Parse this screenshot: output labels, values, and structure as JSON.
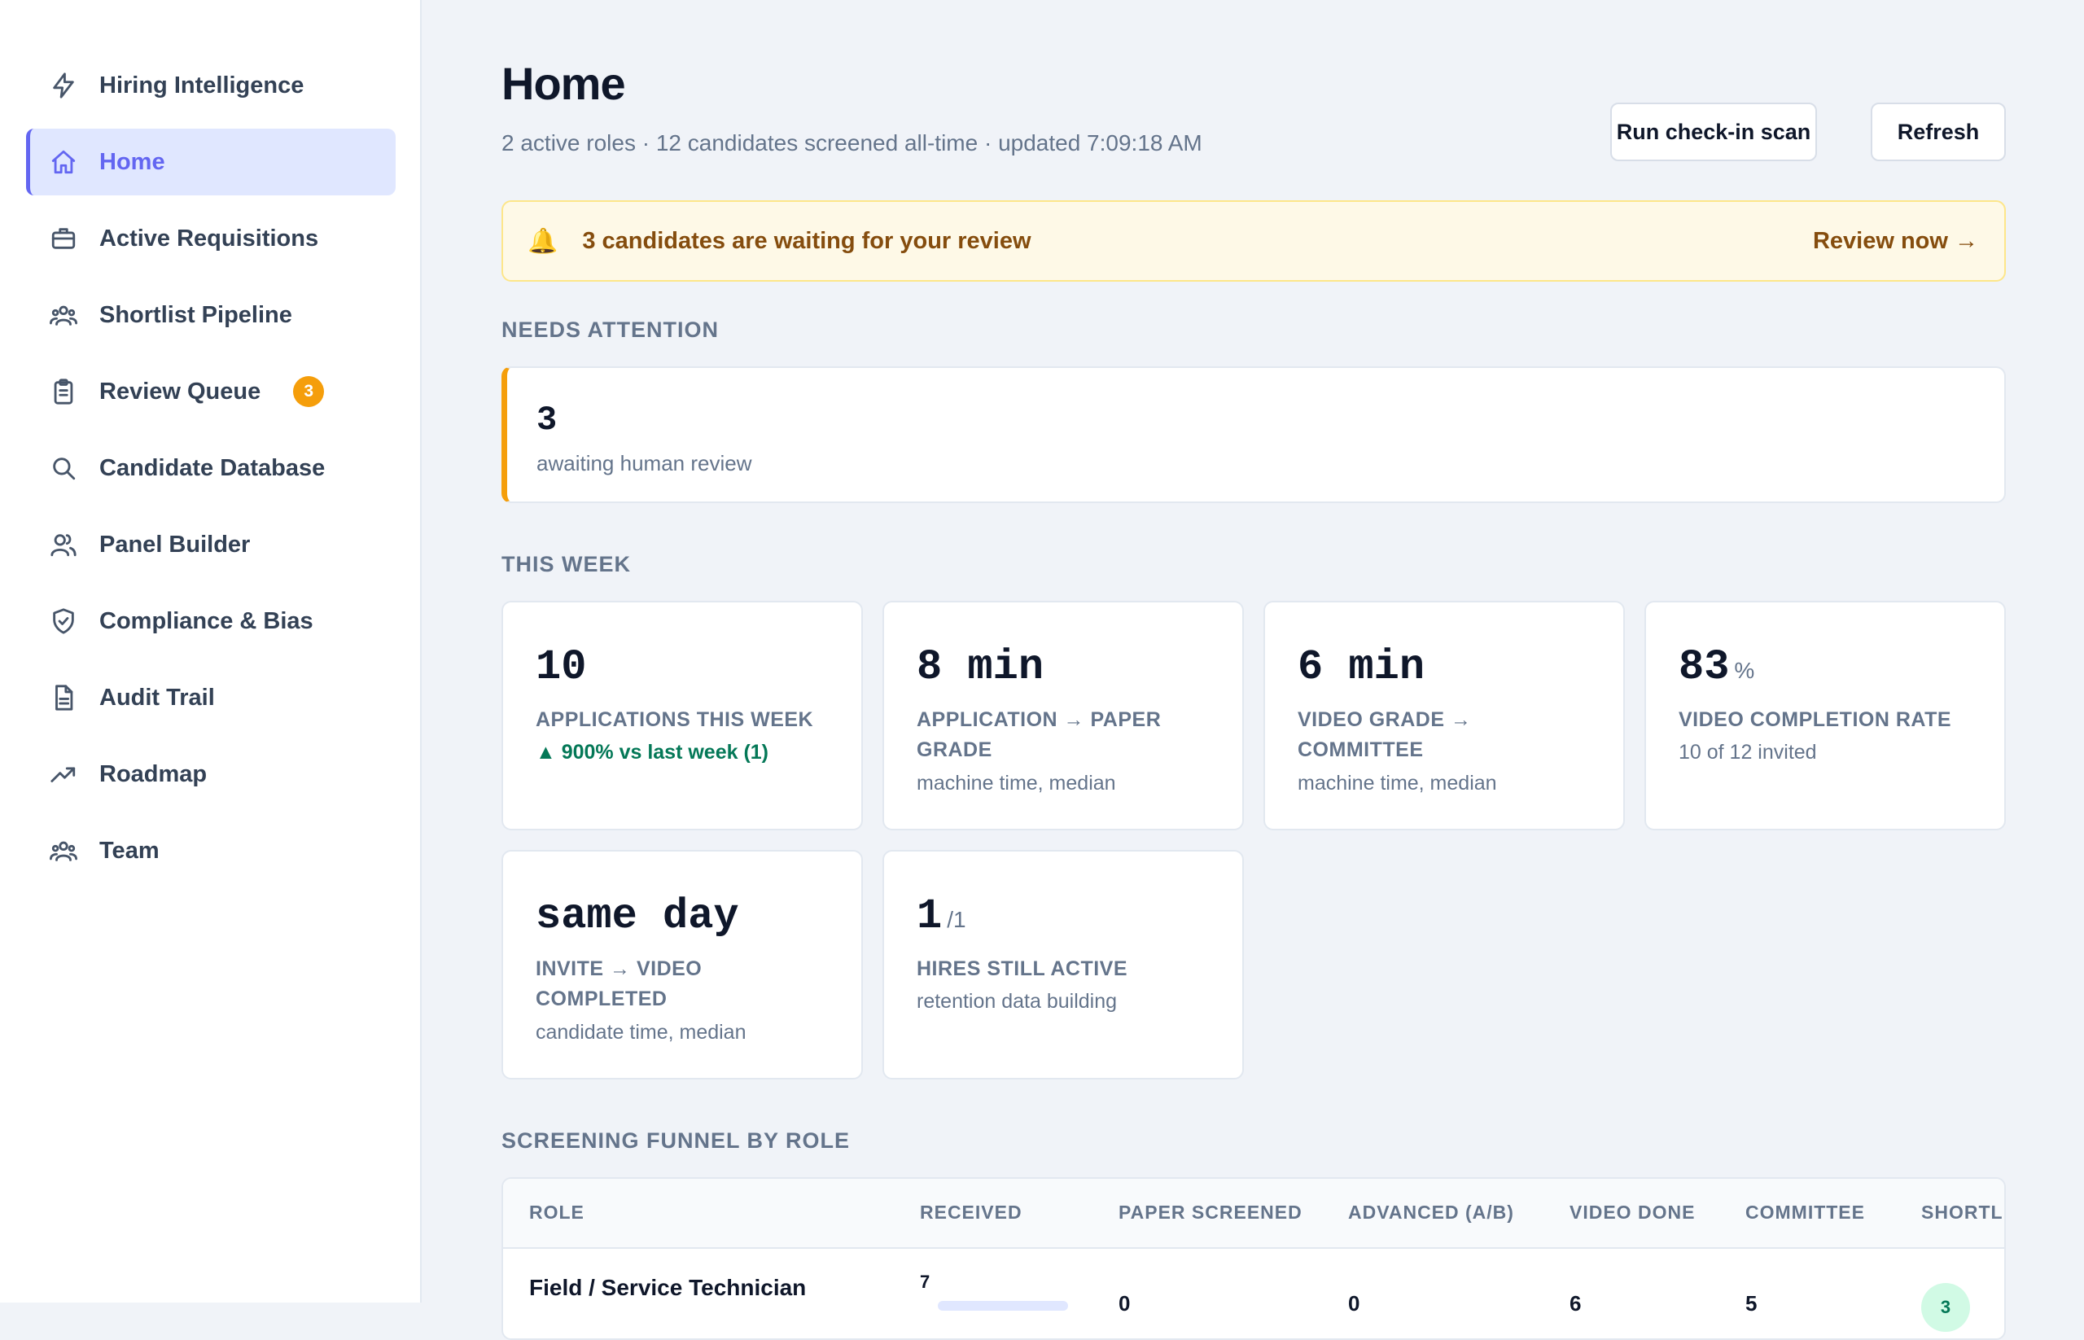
{
  "sidebar": {
    "brand": {
      "label": "Hiring Intelligence",
      "icon": "bolt-icon"
    },
    "items": [
      {
        "label": "Home",
        "icon": "home-icon",
        "active": true
      },
      {
        "label": "Active Requisitions",
        "icon": "briefcase-icon"
      },
      {
        "label": "Shortlist Pipeline",
        "icon": "users-group-icon"
      },
      {
        "label": "Review Queue",
        "icon": "clipboard-icon",
        "badge": "3"
      },
      {
        "label": "Candidate Database",
        "icon": "search-icon"
      },
      {
        "label": "Panel Builder",
        "icon": "users-icon"
      },
      {
        "label": "Compliance & Bias",
        "icon": "shield-check-icon"
      },
      {
        "label": "Audit Trail",
        "icon": "document-icon"
      },
      {
        "label": "Roadmap",
        "icon": "trending-up-icon"
      },
      {
        "label": "Team",
        "icon": "team-icon"
      }
    ]
  },
  "header": {
    "title": "Home",
    "subtitle": "2 active roles · 12 candidates screened all-time · updated 7:09:18 AM",
    "run_scan_label": "Run check-in scan",
    "refresh_label": "Refresh"
  },
  "alert": {
    "icon": "bell-icon",
    "message": "3 candidates are waiting for your review",
    "action": "Review now →",
    "color": "#854d0e"
  },
  "needs_attention": {
    "heading": "NEEDS ATTENTION",
    "value": "3",
    "caption": "awaiting human review",
    "accent": "#f59e0b"
  },
  "this_week": {
    "heading": "THIS WEEK",
    "cards": [
      {
        "value": "10",
        "unit": "",
        "label": "APPLICATIONS THIS WEEK",
        "sub": "",
        "delta": "▲ 900% vs last week (1)"
      },
      {
        "value": "8 min",
        "unit": "",
        "label": "APPLICATION → PAPER GRADE",
        "sub": "machine time, median",
        "delta": ""
      },
      {
        "value": "6 min",
        "unit": "",
        "label": "VIDEO GRADE → COMMITTEE",
        "sub": "machine time, median",
        "delta": ""
      },
      {
        "value": "83",
        "unit": "%",
        "label": "VIDEO COMPLETION RATE",
        "sub": "10 of 12 invited",
        "delta": ""
      },
      {
        "value": "same day",
        "unit": "",
        "label": "INVITE → VIDEO COMPLETED",
        "sub": "candidate time, median",
        "delta": ""
      },
      {
        "value": "1",
        "unit": "/1",
        "label": "HIRES STILL ACTIVE",
        "sub": "retention data building",
        "delta": ""
      }
    ]
  },
  "funnel": {
    "heading": "SCREENING FUNNEL BY ROLE",
    "columns": [
      "ROLE",
      "RECEIVED",
      "PAPER SCREENED",
      "ADVANCED (A/B)",
      "VIDEO DONE",
      "COMMITTEE",
      "SHORTLI"
    ],
    "rows": [
      {
        "role": "Field / Service Technician",
        "received": "7",
        "paper_screened": "0",
        "advanced": "0",
        "video_done": "6",
        "committee": "5",
        "shortlisted": "3"
      }
    ]
  }
}
